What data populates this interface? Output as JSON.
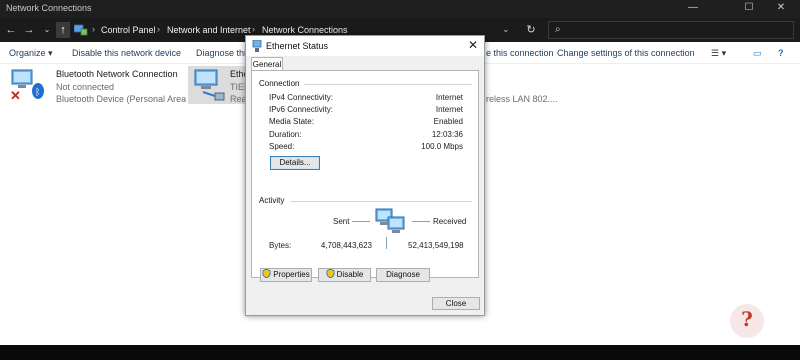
{
  "window": {
    "title": "Network Connections"
  },
  "address": {
    "segments": [
      "Control Panel",
      "Network and Internet",
      "Network Connections"
    ],
    "search_placeholder": ""
  },
  "commands": {
    "organize": "Organize",
    "disable": "Disable this network device",
    "diagnose": "Diagnose thi",
    "rename": "e this connection",
    "change_settings": "Change settings of this connection"
  },
  "connections": [
    {
      "name": "Bluetooth Network Connection",
      "status": "Not connected",
      "device": "Bluetooth Device (Personal Area ..."
    },
    {
      "name": "Ethe",
      "status": "TIEN",
      "device": "Real"
    },
    {
      "name": "",
      "status": "",
      "device": "reless LAN 802...."
    }
  ],
  "dialog": {
    "title": "Ethernet Status",
    "tab": "General",
    "connection_group": "Connection",
    "rows": [
      {
        "label": "IPv4 Connectivity:",
        "value": "Internet"
      },
      {
        "label": "IPv6 Connectivity:",
        "value": "Internet"
      },
      {
        "label": "Media State:",
        "value": "Enabled"
      },
      {
        "label": "Duration:",
        "value": "12:03:36"
      },
      {
        "label": "Speed:",
        "value": "100.0 Mbps"
      }
    ],
    "details_button": "Details...",
    "activity_group": "Activity",
    "sent_label": "Sent",
    "received_label": "Received",
    "bytes_label": "Bytes:",
    "bytes_sent": "4,708,443,623",
    "bytes_received": "52,413,549,198",
    "properties_button": "Properties",
    "disable_button": "Disable",
    "diagnose_button": "Diagnose",
    "close_button": "Close"
  },
  "colors": {
    "accent": "#3c7fb1",
    "dark_chrome": "#1b1b1b"
  },
  "watermark": {
    "icon": "question-mark-icon"
  }
}
